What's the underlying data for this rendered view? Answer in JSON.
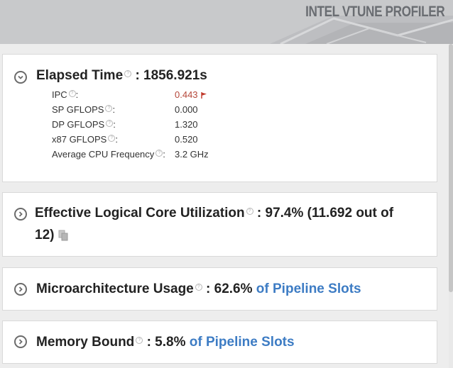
{
  "header": {
    "brand": "INTEL VTUNE PROFILER"
  },
  "elapsed": {
    "label": "Elapsed Time",
    "value": ": 1856.921s",
    "rows": [
      {
        "label": "IPC",
        "colon": ":",
        "value": "0.443",
        "flagged": true
      },
      {
        "label": "SP GFLOPS",
        "colon": ":",
        "value": "0.000"
      },
      {
        "label": "DP GFLOPS",
        "colon": ":",
        "value": "1.320"
      },
      {
        "label": "x87 GFLOPS",
        "colon": ":",
        "value": "0.520"
      },
      {
        "label": "Average CPU Frequency",
        "colon": ":",
        "value": "3.2 GHz"
      }
    ]
  },
  "core_util": {
    "label": "Effective Logical Core Utilization",
    "value_line1": ": 97.4% (11.692 out of",
    "value_line2": "12)"
  },
  "uarch": {
    "label": "Microarchitecture Usage",
    "value": ": 62.6%",
    "suffix": "of Pipeline Slots"
  },
  "memory": {
    "label": "Memory Bound",
    "value": ": 5.8%",
    "suffix": "of Pipeline Slots"
  },
  "help_glyph": "?",
  "colors": {
    "flag": "#c0392b",
    "link_blue": "#3d7cc4",
    "ipc_value": "#b5473a"
  }
}
